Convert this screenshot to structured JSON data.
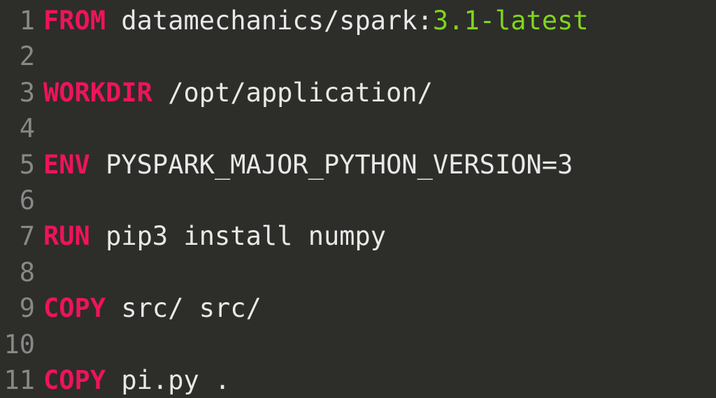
{
  "lines": [
    {
      "num": "1",
      "tokens": [
        {
          "type": "keyword",
          "text": "FROM"
        },
        {
          "type": "plain",
          "text": " datamechanics/spark:"
        },
        {
          "type": "tag",
          "text": "3.1-latest"
        }
      ]
    },
    {
      "num": "2",
      "tokens": []
    },
    {
      "num": "3",
      "tokens": [
        {
          "type": "keyword",
          "text": "WORKDIR"
        },
        {
          "type": "plain",
          "text": " /opt/application/"
        }
      ]
    },
    {
      "num": "4",
      "tokens": []
    },
    {
      "num": "5",
      "tokens": [
        {
          "type": "keyword",
          "text": "ENV"
        },
        {
          "type": "plain",
          "text": " PYSPARK_MAJOR_PYTHON_VERSION=3"
        }
      ]
    },
    {
      "num": "6",
      "tokens": []
    },
    {
      "num": "7",
      "tokens": [
        {
          "type": "keyword",
          "text": "RUN"
        },
        {
          "type": "plain",
          "text": " pip3 install numpy"
        }
      ]
    },
    {
      "num": "8",
      "tokens": []
    },
    {
      "num": "9",
      "tokens": [
        {
          "type": "keyword",
          "text": "COPY"
        },
        {
          "type": "plain",
          "text": " src/ src/"
        }
      ]
    },
    {
      "num": "10",
      "tokens": []
    },
    {
      "num": "11",
      "tokens": [
        {
          "type": "keyword",
          "text": "COPY"
        },
        {
          "type": "plain",
          "text": " pi.py ."
        }
      ]
    }
  ]
}
